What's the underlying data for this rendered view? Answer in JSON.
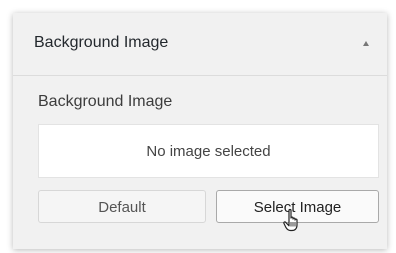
{
  "section": {
    "title": "Background Image"
  },
  "control": {
    "title": "Background Image",
    "placeholder": "No image selected"
  },
  "buttons": {
    "default_label": "Default",
    "select_label": "Select Image"
  },
  "icons": {
    "collapse": "chevron-up-icon",
    "cursor": "hand-pointer-icon"
  },
  "colors": {
    "panel_background": "#f1f1f1",
    "text": "#23282d"
  }
}
